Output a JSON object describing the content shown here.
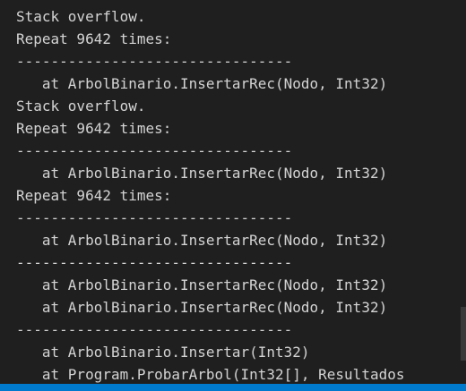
{
  "terminal": {
    "lines": [
      "Stack overflow.",
      "Repeat 9642 times:",
      "--------------------------------",
      "   at ArbolBinario.InsertarRec(Nodo, Int32)",
      "Stack overflow.",
      "Repeat 9642 times:",
      "--------------------------------",
      "   at ArbolBinario.InsertarRec(Nodo, Int32)",
      "Repeat 9642 times:",
      "--------------------------------",
      "   at ArbolBinario.InsertarRec(Nodo, Int32)",
      "--------------------------------",
      "   at ArbolBinario.InsertarRec(Nodo, Int32)",
      "   at ArbolBinario.InsertarRec(Nodo, Int32)",
      "--------------------------------",
      "   at ArbolBinario.Insertar(Int32)",
      "   at Program.ProbarArbol(Int32[], Resultados"
    ]
  },
  "colors": {
    "background": "#1f1f1f",
    "text": "#d4d4d4",
    "status_bar": "#007acc"
  }
}
